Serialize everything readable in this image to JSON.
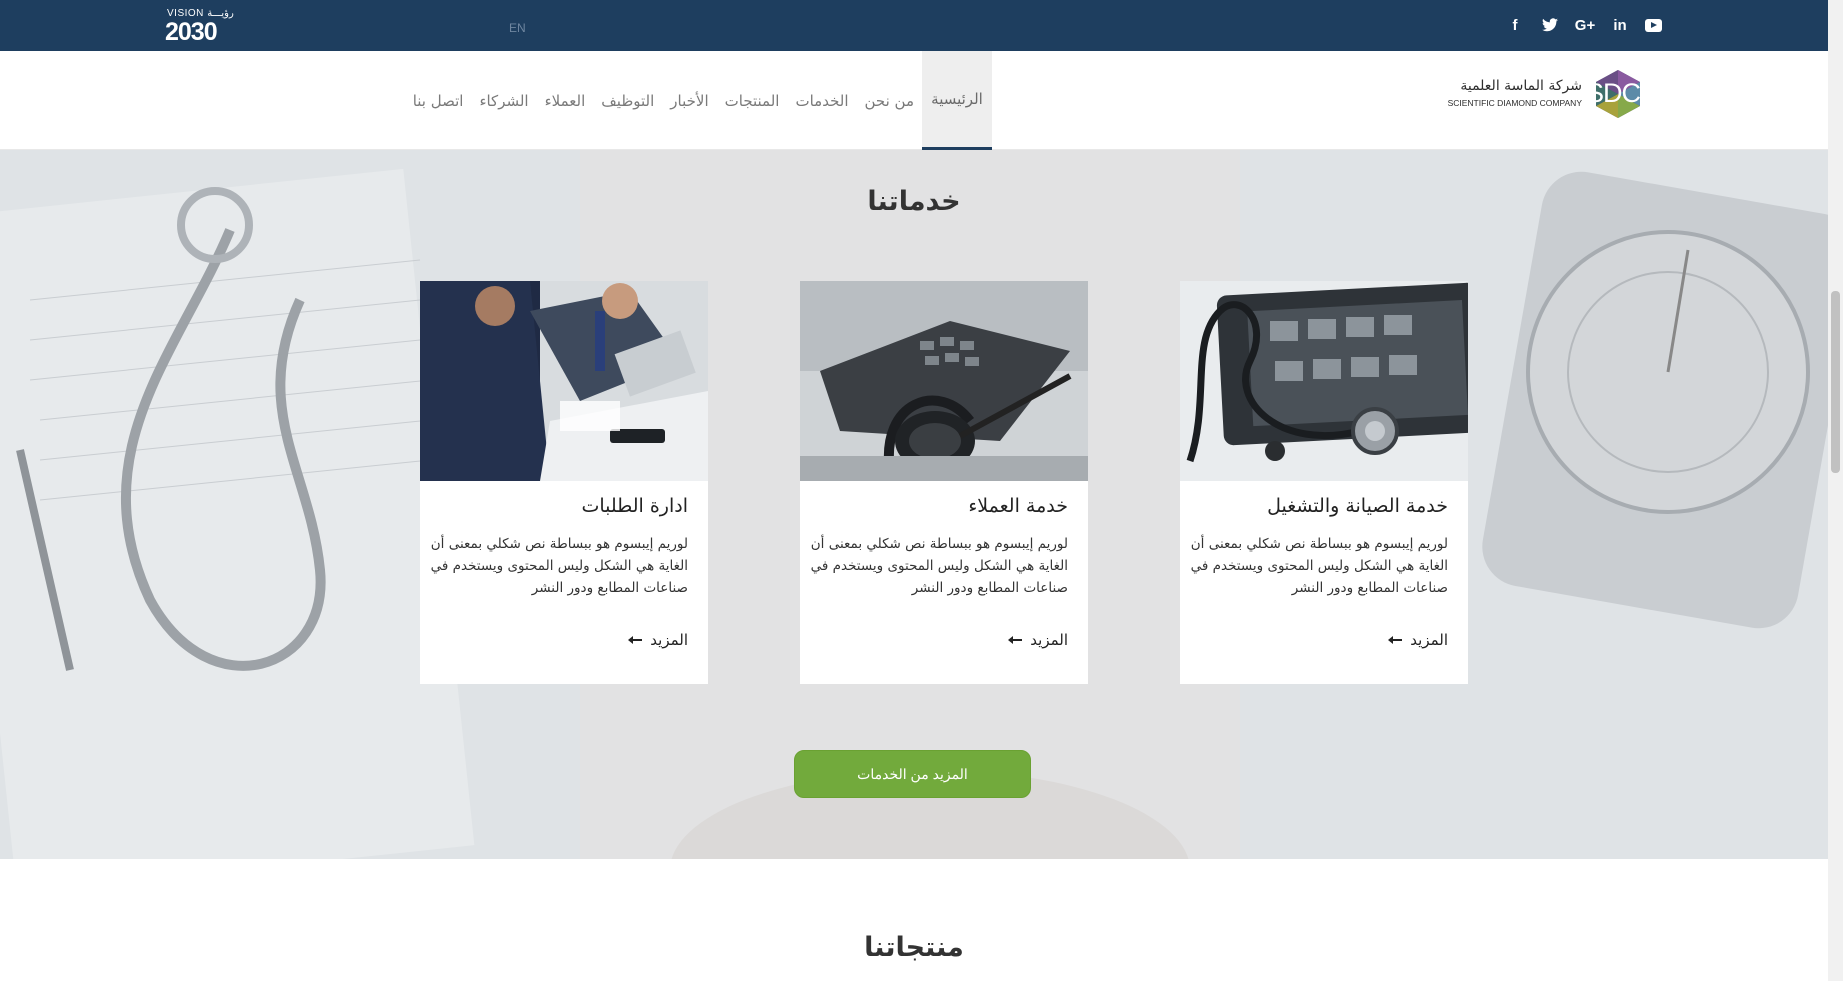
{
  "topbar": {
    "vision_label": "VISION رؤيـــة",
    "vision_year": "2030",
    "lang_label": "EN",
    "social": [
      "facebook-icon",
      "twitter-icon",
      "google-plus-icon",
      "linkedin-icon",
      "youtube-icon"
    ],
    "social_glyphs": {
      "facebook": "f",
      "twitter": "t",
      "google": "G+",
      "linkedin": "in"
    }
  },
  "nav": {
    "items": [
      {
        "label": "الرئيسية",
        "active": true
      },
      {
        "label": "من نحن"
      },
      {
        "label": "الخدمات"
      },
      {
        "label": "المنتجات"
      },
      {
        "label": "الأخبار"
      },
      {
        "label": "التوظيف"
      },
      {
        "label": "العملاء"
      },
      {
        "label": "الشركاء"
      },
      {
        "label": "اتصل بنا"
      }
    ]
  },
  "logo": {
    "arabic_name": "شركة الماسة العلمية",
    "english_name": "SCIENTIFIC DIAMOND COMPANY",
    "mark": "SDC"
  },
  "services": {
    "title": "خدماتنا",
    "cards": [
      {
        "title": "خدمة الصيانة والتشغيل",
        "description": "لوريم إيبسوم هو ببساطة نص شكلي بمعنى أن الغاية هي الشكل وليس المحتوى ويستخدم في صناعات المطابع ودور النشر",
        "more": "المزيد"
      },
      {
        "title": "خدمة العملاء",
        "description": "لوريم إيبسوم هو ببساطة نص شكلي بمعنى أن الغاية هي الشكل وليس المحتوى ويستخدم في صناعات المطابع ودور النشر",
        "more": "المزيد"
      },
      {
        "title": "ادارة الطلبات",
        "description": "لوريم إيبسوم هو ببساطة نص شكلي بمعنى أن الغاية هي الشكل وليس المحتوى ويستخدم في صناعات المطابع ودور النشر",
        "more": "المزيد"
      }
    ],
    "more_button": "المزيد من الخدمات"
  },
  "products": {
    "title": "منتجاتنا"
  },
  "colors": {
    "topbar": "#1e3e5f",
    "accent_green": "#72aa3c",
    "active_underline": "#1e3e5f"
  }
}
